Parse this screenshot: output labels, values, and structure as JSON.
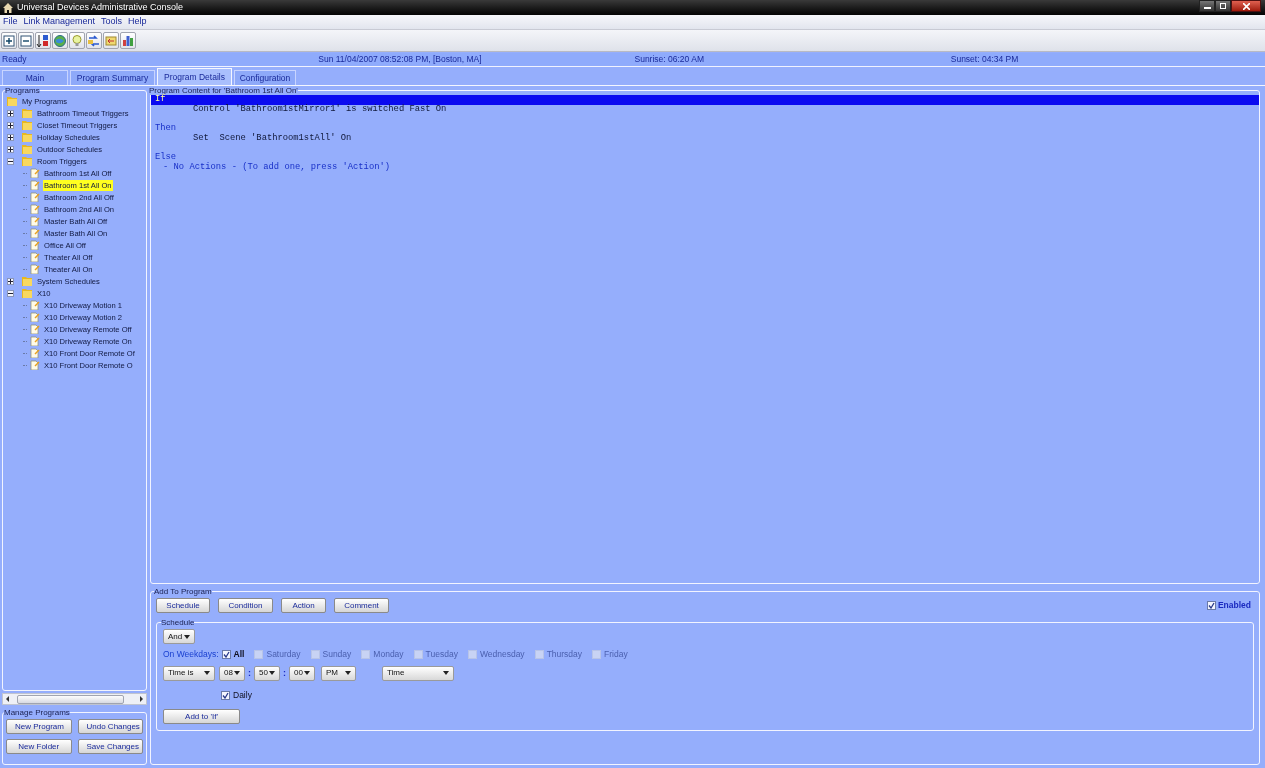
{
  "window": {
    "title": "Universal Devices Administrative Console"
  },
  "menu": [
    "File",
    "Link Management",
    "Tools",
    "Help"
  ],
  "status_bar": {
    "status": "Ready",
    "datetime": "Sun 11/04/2007 08:52:08 PM,  [Boston, MA]",
    "sunrise": "Sunrise: 06:20 AM",
    "sunset": "Sunset: 04:34 PM"
  },
  "tabs": [
    {
      "label": "Main",
      "selected": false
    },
    {
      "label": "Program Summary",
      "selected": false
    },
    {
      "label": "Program Details",
      "selected": true
    },
    {
      "label": "Configuration",
      "selected": false
    }
  ],
  "programs": {
    "title": "Programs",
    "tree": [
      {
        "label": "My Programs",
        "kind": "root",
        "selected": false,
        "children": [
          {
            "label": "Bathroom Timeout Triggers",
            "kind": "folder",
            "expanded": false,
            "selected": false
          },
          {
            "label": "Closet Timeout Triggers",
            "kind": "folder",
            "expanded": false,
            "selected": false
          },
          {
            "label": "Holiday Schedules",
            "kind": "folder",
            "expanded": false,
            "selected": false
          },
          {
            "label": "Outdoor Schedules",
            "kind": "folder",
            "expanded": false,
            "selected": false
          },
          {
            "label": "Room Triggers",
            "kind": "folder",
            "expanded": true,
            "selected": false,
            "children": [
              {
                "label": "Bathroom 1st All Off",
                "kind": "program",
                "selected": false
              },
              {
                "label": "Bathroom 1st All On",
                "kind": "program",
                "selected": true
              },
              {
                "label": "Bathroom 2nd All Off",
                "kind": "program",
                "selected": false
              },
              {
                "label": "Bathroom 2nd All On",
                "kind": "program",
                "selected": false
              },
              {
                "label": "Master Bath All Off",
                "kind": "program",
                "selected": false
              },
              {
                "label": "Master Bath All On",
                "kind": "program",
                "selected": false
              },
              {
                "label": "Office All Off",
                "kind": "program",
                "selected": false
              },
              {
                "label": "Theater All Off",
                "kind": "program",
                "selected": false
              },
              {
                "label": "Theater All On",
                "kind": "program",
                "selected": false
              }
            ]
          },
          {
            "label": "System Schedules",
            "kind": "folder",
            "expanded": false,
            "selected": false
          },
          {
            "label": "X10",
            "kind": "folder",
            "expanded": true,
            "selected": false,
            "children": [
              {
                "label": "X10 Driveway Motion 1",
                "kind": "program",
                "selected": false
              },
              {
                "label": "X10 Driveway Motion 2",
                "kind": "program",
                "selected": false
              },
              {
                "label": "X10 Driveway Remote Off",
                "kind": "program",
                "selected": false
              },
              {
                "label": "X10 Driveway Remote On",
                "kind": "program",
                "selected": false
              },
              {
                "label": "X10 Front Door Remote Of",
                "kind": "program",
                "selected": false
              },
              {
                "label": "X10 Front Door Remote O",
                "kind": "program",
                "selected": false
              }
            ]
          }
        ]
      }
    ]
  },
  "manage": {
    "title": "Manage Programs",
    "buttons": [
      "New Program",
      "Undo Changes",
      "New Folder",
      "Save Changes"
    ]
  },
  "content": {
    "title": "Program Content for 'Bathroom 1st All On'",
    "lines": [
      {
        "text": "If",
        "kind": "keyword",
        "selected": true
      },
      {
        "text": "Control 'Bathroom1stMirror1' is switched Fast On",
        "kind": "statement",
        "selected": false
      },
      {
        "text": "Then",
        "kind": "keyword",
        "selected": false
      },
      {
        "text": "Set  Scene 'Bathroom1stAll' On",
        "kind": "statement",
        "selected": false
      },
      {
        "text": "Else",
        "kind": "keyword",
        "selected": false
      },
      {
        "text": "- No Actions - (To add one, press 'Action')",
        "kind": "note",
        "selected": false
      }
    ]
  },
  "add_to_program": {
    "title": "Add To Program",
    "buttons": [
      "Schedule",
      "Condition",
      "Action",
      "Comment"
    ],
    "enabled": {
      "label": "Enabled",
      "checked": true
    }
  },
  "schedule": {
    "title": "Schedule",
    "conjunction": "And",
    "weekdays_label": "On Weekdays:",
    "days": [
      {
        "label": "All",
        "checked": true,
        "disabled": false
      },
      {
        "label": "Saturday",
        "checked": false,
        "disabled": true
      },
      {
        "label": "Sunday",
        "checked": false,
        "disabled": true
      },
      {
        "label": "Monday",
        "checked": false,
        "disabled": true
      },
      {
        "label": "Tuesday",
        "checked": false,
        "disabled": true
      },
      {
        "label": "Wednesday",
        "checked": false,
        "disabled": true
      },
      {
        "label": "Thursday",
        "checked": false,
        "disabled": true
      },
      {
        "label": "Friday",
        "checked": false,
        "disabled": true
      }
    ],
    "time_row": [
      {
        "kind": "dropdown",
        "value": "Time is"
      },
      {
        "kind": "dropdown",
        "value": "08"
      },
      {
        "kind": "separator",
        "value": ":"
      },
      {
        "kind": "dropdown",
        "value": "50"
      },
      {
        "kind": "separator",
        "value": ":"
      },
      {
        "kind": "dropdown",
        "value": "00"
      },
      {
        "kind": "dropdown",
        "value": "PM"
      },
      {
        "kind": "dropdown",
        "value": "Time"
      }
    ],
    "daily": {
      "label": "Daily",
      "checked": true
    },
    "add_button": "Add to 'If'"
  }
}
